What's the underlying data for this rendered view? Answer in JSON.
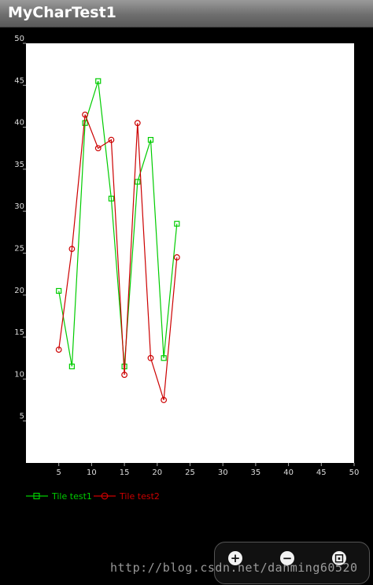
{
  "app": {
    "title": "MyCharTest1"
  },
  "colors": {
    "series1": "#00cc00",
    "series2": "#cc0000",
    "plot_bg": "#ffffff",
    "axis_text": "#dddddd"
  },
  "chart_data": {
    "type": "line",
    "title": "",
    "xlabel": "",
    "ylabel": "",
    "xlim": [
      0,
      50
    ],
    "ylim": [
      0,
      50
    ],
    "xticks": [
      5,
      10,
      15,
      20,
      25,
      30,
      35,
      40,
      45,
      50
    ],
    "yticks": [
      5,
      10,
      15,
      20,
      25,
      30,
      35,
      40,
      45,
      50
    ],
    "grid": false,
    "legend_position": "bottom-left",
    "series": [
      {
        "name": "Tile test1",
        "marker": "square",
        "color": "#00cc00",
        "x": [
          5,
          7,
          9,
          11,
          13,
          15,
          17,
          19,
          21,
          23
        ],
        "y": [
          20.5,
          11.5,
          40.5,
          45.5,
          31.5,
          11.5,
          33.5,
          38.5,
          12.5,
          28.5
        ]
      },
      {
        "name": "Tile test2",
        "marker": "circle",
        "color": "#cc0000",
        "x": [
          5,
          7,
          9,
          11,
          13,
          15,
          17,
          19,
          21,
          23
        ],
        "y": [
          13.5,
          25.5,
          41.5,
          37.5,
          38.5,
          10.5,
          40.5,
          12.5,
          7.5,
          24.5
        ]
      }
    ]
  },
  "zoom": {
    "in_label": "+",
    "out_label": "−",
    "fit_label": "⊡"
  },
  "watermark": "http://blog.csdn.net/danming60520"
}
